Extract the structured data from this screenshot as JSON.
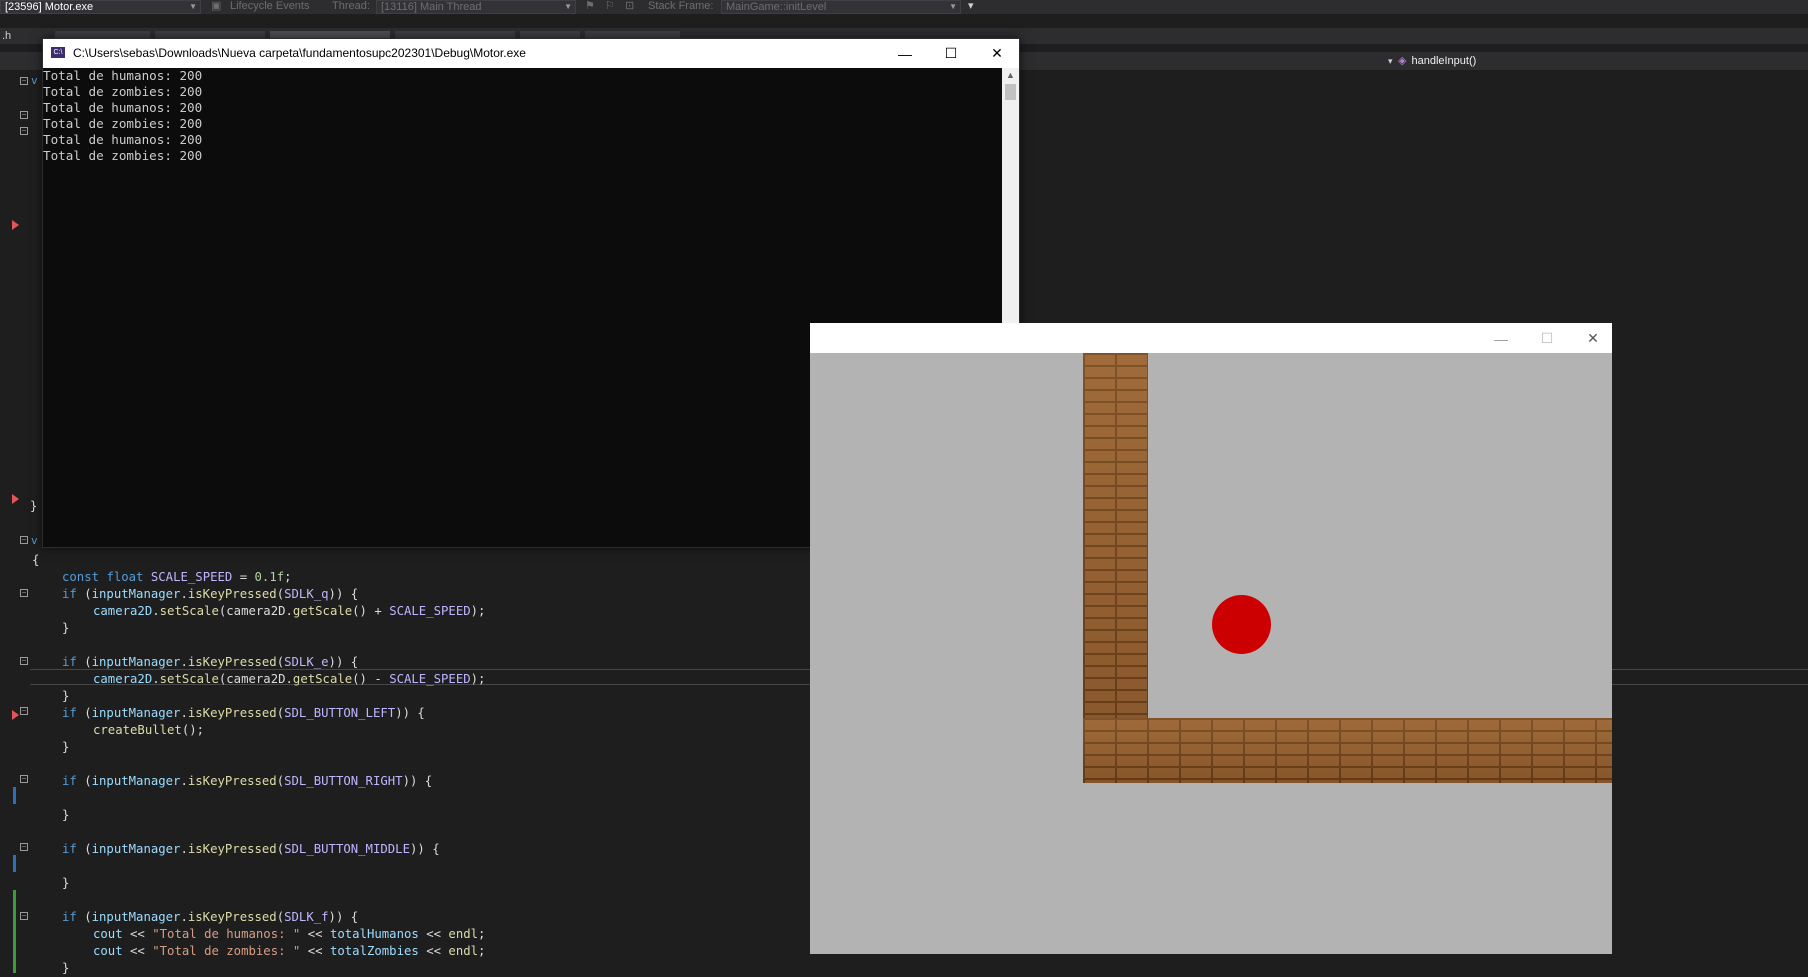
{
  "toolbar": {
    "process": "[23596] Motor.exe",
    "lifecycle": "Lifecycle Events",
    "thread_label": "Thread:",
    "thread": "[13116] Main Thread",
    "stack_label": "Stack Frame:",
    "stack": "MainGame::initLevel"
  },
  "tabs": {
    "first_fragment": ".h"
  },
  "nav": {
    "method": "handleInput()"
  },
  "console": {
    "title": "C:\\Users\\sebas\\Downloads\\Nueva carpeta\\fundamentosupc202301\\Debug\\Motor.exe",
    "lines": [
      "Total de humanos: 200",
      "Total de zombies: 200",
      "Total de humanos: 200",
      "Total de zombies: 200",
      "Total de humanos: 200",
      "Total de zombies: 200"
    ],
    "minimize": "—",
    "maximize": "☐",
    "close": "✕"
  },
  "code": {
    "open_brace": "{",
    "close_brace_top": "}",
    "line_scale_speed": {
      "k1": "const",
      "k2": "float",
      "name": "SCALE_SPEED",
      "eq": " = ",
      "val": "0.1f",
      "end": ";"
    },
    "ifs": [
      {
        "fn": "isKeyPressed",
        "arg": "SDLK_q",
        "body_obj": "camera2D",
        "body_fn": "setScale",
        "body_rest": "(camera2D.",
        "body_fn2": "getScale",
        "body_op": "() + ",
        "body_var": "SCALE_SPEED",
        "body_end": ");"
      },
      {
        "fn": "isKeyPressed",
        "arg": "SDLK_e",
        "body_obj": "camera2D",
        "body_fn": "setScale",
        "body_rest": "(camera2D.",
        "body_fn2": "getScale",
        "body_op": "() - ",
        "body_var": "SCALE_SPEED",
        "body_end": ");"
      }
    ],
    "if_left": {
      "arg": "SDL_BUTTON_LEFT",
      "body": "createBullet"
    },
    "if_right": {
      "arg": "SDL_BUTTON_RIGHT"
    },
    "if_middle": {
      "arg": "SDL_BUTTON_MIDDLE"
    },
    "if_f": {
      "arg": "SDLK_f",
      "str1": "\"Total de humanos: \"",
      "var1": "totalHumanos",
      "str2": "\"Total de zombies: \"",
      "var2": "totalZombies"
    },
    "tokens": {
      "if": "if",
      "inputManager": "inputManager",
      "cout": "cout",
      "endl": "endl",
      "shift": " << "
    }
  },
  "game": {
    "minimize": "—",
    "maximize": "☐",
    "close": "✕",
    "colors": {
      "background": "#b3b3b3",
      "brick": "#8a5a2e",
      "ball": "#cc0000"
    }
  }
}
